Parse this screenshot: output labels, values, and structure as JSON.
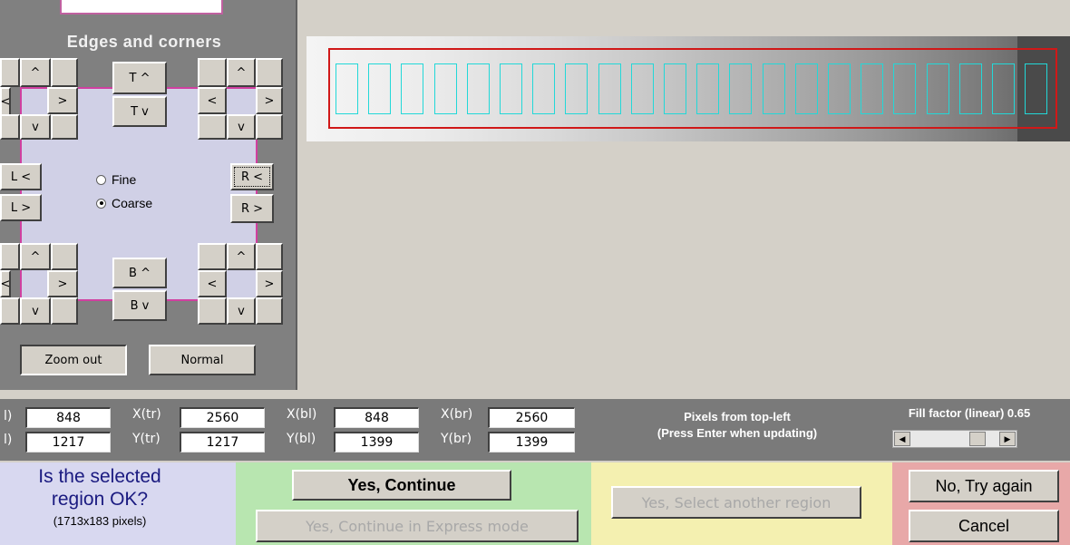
{
  "panel": {
    "title": "Edges and corners",
    "top_button": "T ^",
    "top_down": "T v",
    "bottom_up": "B ^",
    "bottom_down": "B v",
    "left_left": "L <",
    "left_right": "L >",
    "right_left": "R <",
    "right_right": "R >",
    "up": "^",
    "down": "v",
    "left": "<",
    "right": ">",
    "radio_fine": "Fine",
    "radio_coarse": "Coarse",
    "selected_mode": "Coarse",
    "zoom_out": "Zoom out",
    "normal": "Normal"
  },
  "coords": {
    "x_tl_label": "l)",
    "x_tl": "848",
    "x_tr_label": "X(tr)",
    "x_tr": "2560",
    "x_bl_label": "X(bl)",
    "x_bl": "848",
    "x_br_label": "X(br)",
    "x_br": "2560",
    "y_tl_label": "l)",
    "y_tl": "1217",
    "y_tr_label": "Y(tr)",
    "y_tr": "1217",
    "y_bl_label": "Y(bl)",
    "y_bl": "1399",
    "y_br_label": "Y(br)",
    "y_br": "1399",
    "pixels_info_1": "Pixels from top-left",
    "pixels_info_2": "(Press Enter when updating)",
    "fill_factor": "Fill factor (linear) 0.65"
  },
  "prompt": {
    "question_1": "Is the selected",
    "question_2": "region OK?",
    "size": "(1713x183 pixels)"
  },
  "actions": {
    "yes_continue": "Yes, Continue",
    "yes_express": "Yes, Continue in Express mode",
    "yes_another": "Yes, Select another region",
    "no_try": "No, Try again",
    "cancel": "Cancel"
  },
  "colors": {
    "roi_box": "#d01818",
    "patch_box": "#22d8d8"
  }
}
